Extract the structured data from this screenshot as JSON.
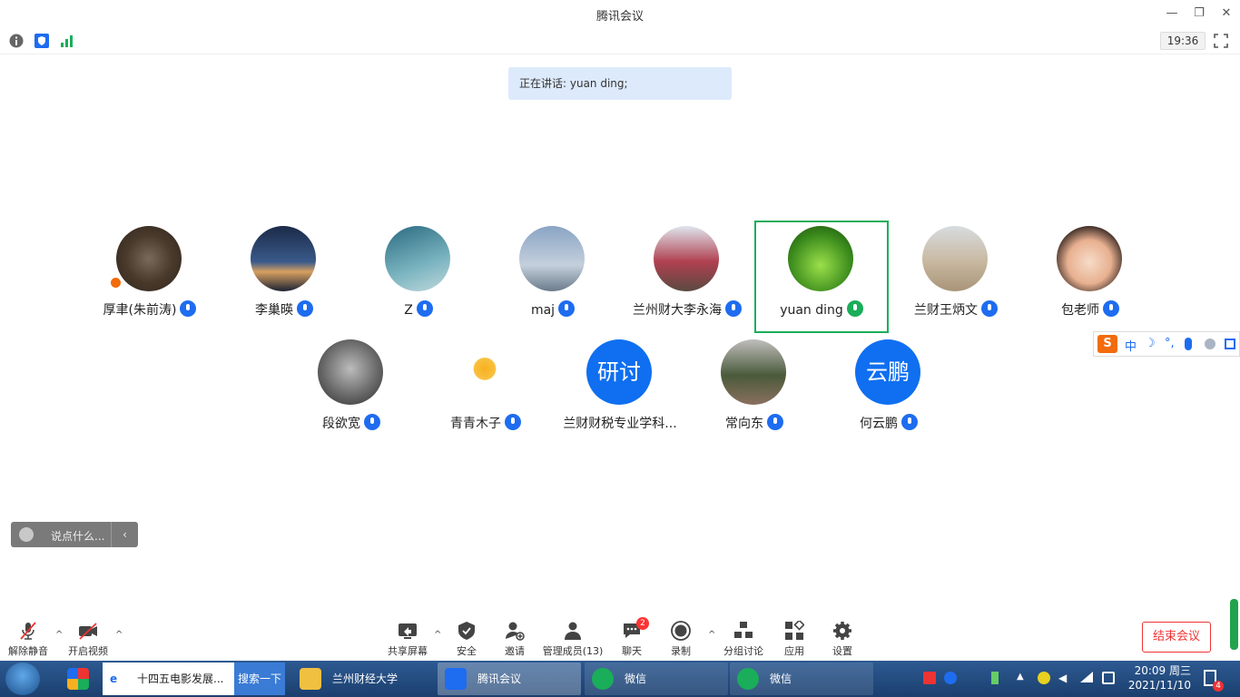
{
  "window": {
    "title": "腾讯会议",
    "minimize": "—",
    "restore": "❐",
    "close": "✕"
  },
  "header": {
    "clock": "19:36"
  },
  "banner": {
    "speaking": "正在讲话: yuan ding;"
  },
  "participants": [
    {
      "name": "厚聿(朱前涛)",
      "host": true
    },
    {
      "name": "李巢暎"
    },
    {
      "name": "Z"
    },
    {
      "name": "maj"
    },
    {
      "name": "兰州财大李永海"
    },
    {
      "name": "yuan ding",
      "speaking": true
    },
    {
      "name": "兰财王炳文"
    },
    {
      "name": "包老师"
    },
    {
      "name": "段欲宽"
    },
    {
      "name": "青青木子"
    },
    {
      "name": "兰财财税专业学科...",
      "avatar_text": "研讨"
    },
    {
      "name": "常向东"
    },
    {
      "name": "何云鹏",
      "avatar_text": "云鹏"
    }
  ],
  "chat_input": {
    "placeholder": "说点什么...",
    "collapse": "‹"
  },
  "ime": {
    "lang": "中",
    "moon": "☽",
    "punct": "°,"
  },
  "toolbar": {
    "unmute": "解除静音",
    "video": "开启视频",
    "share": "共享屏幕",
    "security": "安全",
    "invite": "邀请",
    "members": "管理成员(13)",
    "chat": "聊天",
    "chat_badge": "2",
    "record": "录制",
    "breakout": "分组讨论",
    "apps": "应用",
    "settings": "设置",
    "end": "结束会议"
  },
  "taskbar": {
    "ie_tab": "十四五电影发展...",
    "search": "搜索一下",
    "folder": "兰州财经大学",
    "meeting": "腾讯会议",
    "wechat1": "微信",
    "wechat2": "微信",
    "time": "20:09 周三",
    "date": "2021/11/10",
    "notify": "4"
  },
  "colors": {
    "accent": "#1e6cf0",
    "speaking": "#1aad5a",
    "end": "#e33333"
  }
}
